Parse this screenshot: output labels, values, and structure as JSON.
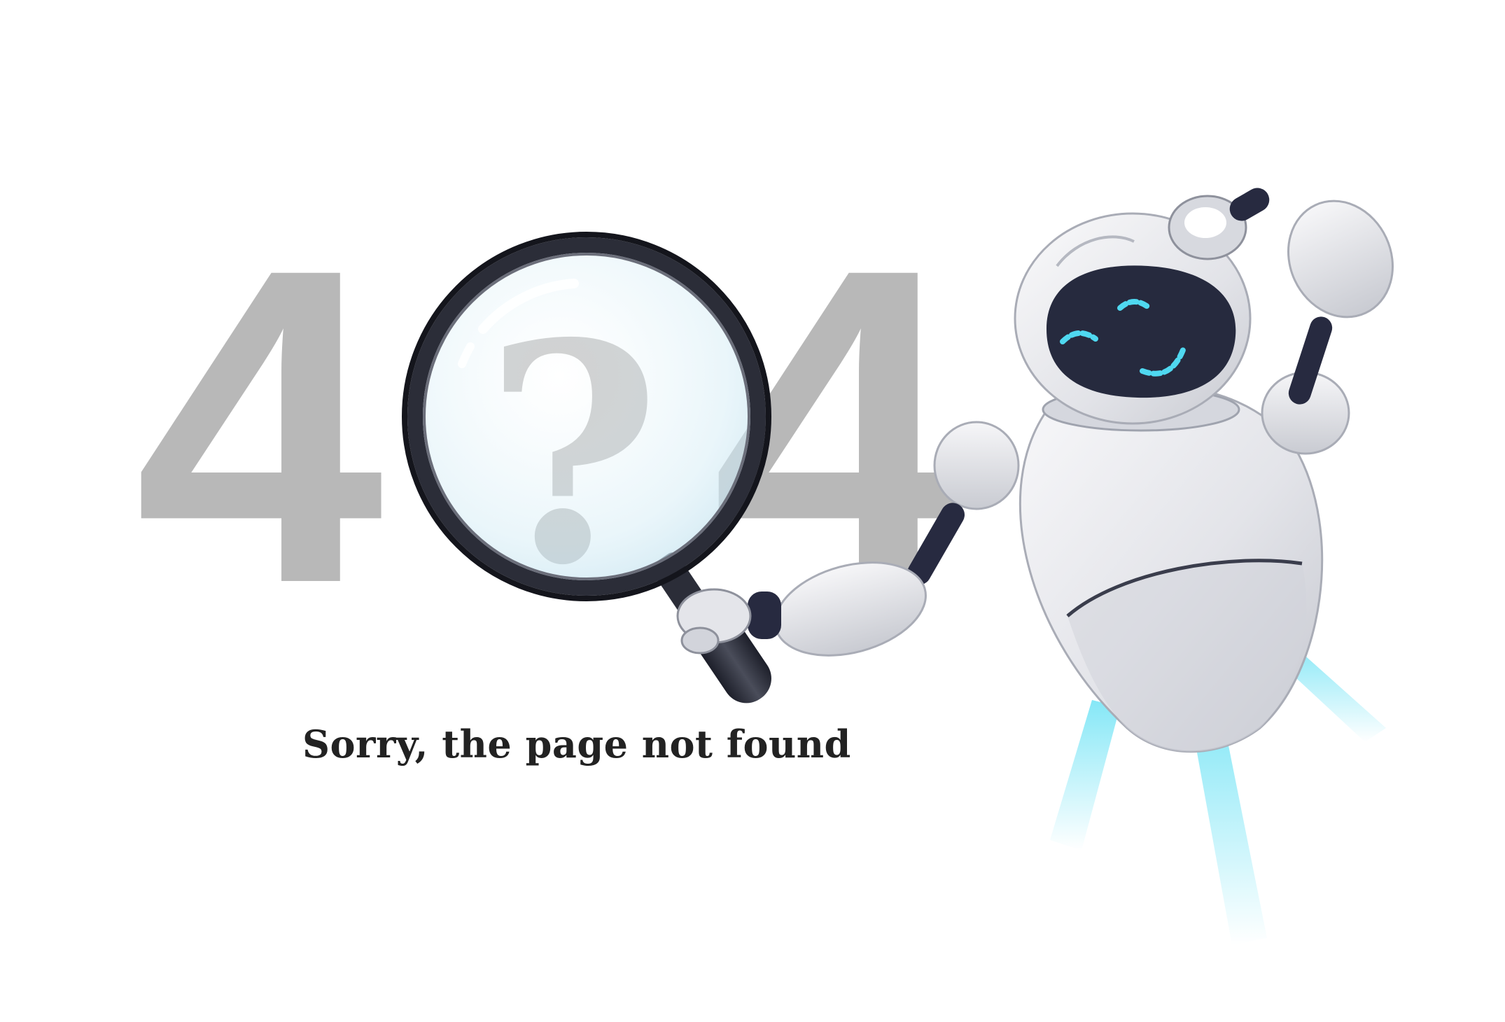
{
  "error": {
    "digit_left": "4",
    "glyph_middle": "?",
    "digit_right": "4",
    "message": "Sorry, the page not found"
  },
  "illustration": {
    "magnifier": "magnifying-glass-icon",
    "character": "robot-mascot"
  },
  "colors": {
    "background": "#ffffff",
    "digits": "#b8b8b8",
    "message_text": "#222222",
    "robot_body": "#e4e5ea",
    "robot_joint": "#272a40",
    "robot_visor": "#262a3e",
    "robot_eyes": "#4fd8f0",
    "thruster_glow": "#6fe3f5",
    "lens_tint": "#d8eef6"
  }
}
